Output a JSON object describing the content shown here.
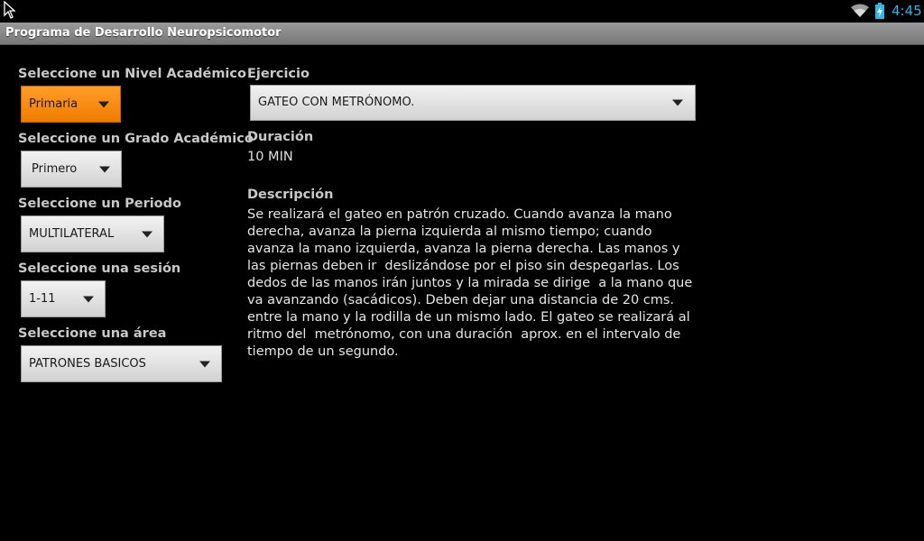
{
  "status_bar": {
    "time": "4:45",
    "icons": [
      "cursor-icon",
      "wifi-icon",
      "battery-charging-icon"
    ],
    "clock_color": "#33b5e5"
  },
  "app": {
    "title": "Programa de Desarrollo Neuropsicomotor"
  },
  "left_panel": {
    "nivel": {
      "label": "Seleccione un Nivel Académico",
      "value": "Primaria"
    },
    "grado": {
      "label": "Seleccione un Grado Académico",
      "value": "Primero"
    },
    "periodo": {
      "label": "Seleccione un Periodo",
      "value": "MULTILATERAL"
    },
    "sesion": {
      "label": "Seleccione una sesión",
      "value": "1-11"
    },
    "area": {
      "label": "Seleccione una área",
      "value": "PATRONES BASICOS"
    }
  },
  "right_panel": {
    "ejercicio": {
      "label": "Ejercicio",
      "value": "GATEO CON METRÓNOMO."
    },
    "duracion": {
      "label": "Duración",
      "value": "10 MIN"
    },
    "descripcion": {
      "label": "Descripción",
      "text": "Se realizará el gateo en patrón cruzado. Cuando avanza la mano\nderecha, avanza la pierna izquierda al mismo tiempo; cuando\navanza la mano izquierda, avanza la pierna derecha. Las manos y\nlas piernas deben ir  deslizándose por el piso sin despegarlas. Los\ndedos de las manos irán juntos y la mirada se dirige  a la mano que\nva avanzando (sacádicos). Deben dejar una distancia de 20 cms.\nentre la mano y la rodilla de un mismo lado. El gateo se realizará al\nritmo del  metrónomo, con una duración  aprox. en el intervalo de\ntiempo de un segundo."
    }
  },
  "colors": {
    "background": "#000000",
    "active_spinner": "#f58400",
    "title_bar": "#8a8a8a"
  }
}
